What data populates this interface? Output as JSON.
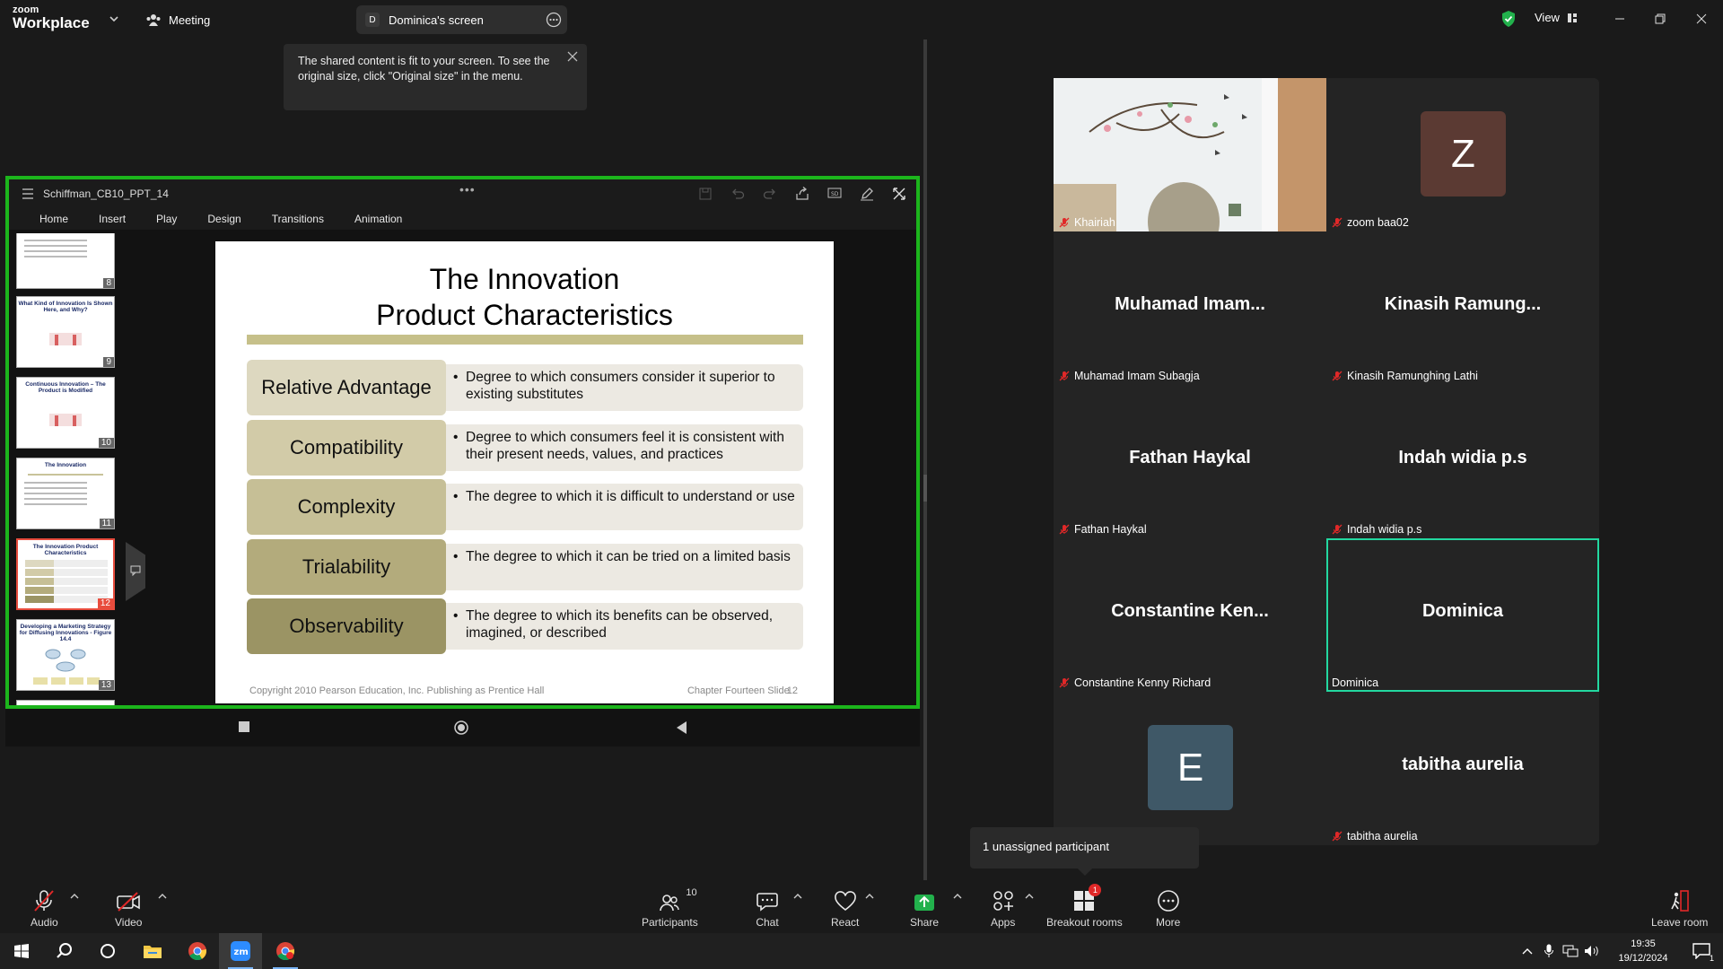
{
  "app": {
    "brand_line1": "zoom",
    "brand_line2": "Workplace",
    "meeting_label": "Meeting",
    "screen_avatar": "D",
    "screen_label": "Dominica's screen",
    "view_label": "View"
  },
  "tooltip": {
    "text": "The shared content is fit to your screen. To see the original size, click \"Original size\" in the menu."
  },
  "shared_app": {
    "doc_title": "Schiffman_CB10_PPT_14",
    "ribbon": [
      "Home",
      "Insert",
      "Play",
      "Design",
      "Transitions",
      "Animation"
    ],
    "thumbnails": [
      {
        "num": "8",
        "title": ""
      },
      {
        "num": "9",
        "title": "What Kind of Innovation Is Shown Here, and Why?"
      },
      {
        "num": "10",
        "title": "Continuous Innovation – The Product is Modified"
      },
      {
        "num": "11",
        "title": "The Innovation"
      },
      {
        "num": "12",
        "title": "The Innovation Product Characteristics"
      },
      {
        "num": "13",
        "title": "Developing a Marketing Strategy for Diffusing Innovations - Figure 14.4"
      }
    ]
  },
  "slide": {
    "title_line1": "The Innovation",
    "title_line2": "Product Characteristics",
    "rows": [
      {
        "label": "Relative Advantage",
        "desc": "Degree to which consumers consider it superior to existing substitutes",
        "color": "#ddd8c0"
      },
      {
        "label": "Compatibility",
        "desc": "Degree to which consumers feel it is consistent with their present needs, values, and practices",
        "color": "#d2cba8"
      },
      {
        "label": "Complexity",
        "desc": "The degree to which it is difficult to understand or use",
        "color": "#c6bf96"
      },
      {
        "label": "Trialability",
        "desc": "The degree to which it can be tried on a limited basis",
        "color": "#b3ab7c"
      },
      {
        "label": "Observability",
        "desc": "The degree to which its benefits can be observed, imagined, or described",
        "color": "#9b9464"
      }
    ],
    "footer_left": "Copyright 2010 Pearson Education, Inc. Publishing as Prentice Hall",
    "footer_right": "Chapter Fourteen Slide",
    "footer_num": "12"
  },
  "participants": [
    {
      "big": "",
      "name": "Khairiah",
      "muted": true
    },
    {
      "big": "",
      "avatar": "Z",
      "avatar_color": "#5b3a33",
      "name": "zoom baa02",
      "muted": true
    },
    {
      "big": "Muhamad  Imam...",
      "name": "Muhamad Imam Subagja",
      "muted": true
    },
    {
      "big": "Kinasih  Ramung...",
      "name": "Kinasih Ramunghing Lathi",
      "muted": true
    },
    {
      "big": "Fathan Haykal",
      "name": "Fathan Haykal",
      "muted": true
    },
    {
      "big": "Indah widia p.s",
      "name": "Indah widia p.s",
      "muted": true
    },
    {
      "big": "Constantine  Ken...",
      "name": "Constantine Kenny Richard",
      "muted": true
    },
    {
      "big": "Dominica",
      "name": "Dominica",
      "muted": false
    },
    {
      "big": "",
      "avatar": "E",
      "avatar_color": "#3f5867",
      "name": "",
      "muted": false
    },
    {
      "big": "tabitha aurelia",
      "name": "tabitha aurelia",
      "muted": true
    }
  ],
  "unassigned": "1 unassigned participant",
  "toolbar": {
    "audio": "Audio",
    "video": "Video",
    "participants": "Participants",
    "participants_count": "10",
    "chat": "Chat",
    "react": "React",
    "share": "Share",
    "apps": "Apps",
    "breakout": "Breakout rooms",
    "breakout_badge": "1",
    "more": "More",
    "leave": "Leave room"
  },
  "taskbar": {
    "time": "19:35",
    "date": "19/12/2024",
    "notif_count": "1"
  },
  "colors": {
    "accent_green": "#1cb51c",
    "active_speaker": "#23d8a0",
    "mute_red": "#e02828"
  }
}
